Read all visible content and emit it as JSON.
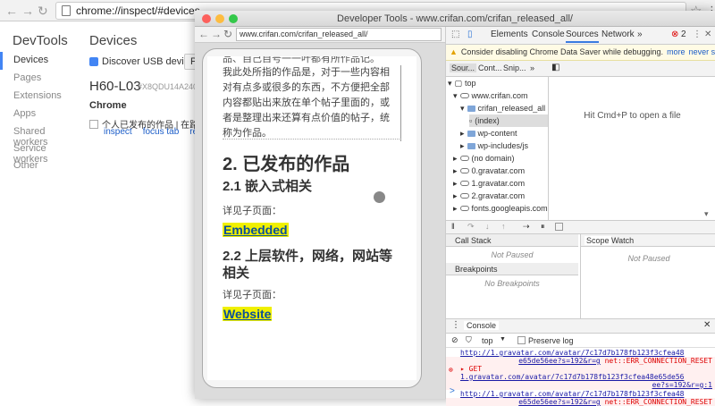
{
  "browser": {
    "url": "chrome://inspect/#devices"
  },
  "inspect": {
    "title": "DevTools",
    "sidebar": [
      "Devices",
      "Pages",
      "Extensions",
      "Apps",
      "Shared workers",
      "Service workers",
      "Other"
    ],
    "heading": "Devices",
    "discover_label": "Discover USB devices",
    "port_btn": "P",
    "device_model": "H60-L03",
    "device_serial": "#X8QDU14A2400",
    "chrome_label": "Chrome",
    "tab_title": "个人已发布的作品 | 在路上",
    "links": [
      "inspect",
      "focus tab",
      "reload"
    ]
  },
  "devtools": {
    "window_title": "Developer Tools - www.crifan.com/crifan_released_all/",
    "page_url": "www.crifan.com/crifan_released_all/",
    "page": {
      "top_clip": "品、自己自号一一叶都有所作品记。",
      "intro": "我此处所指的作品是，对于一些内容相对有点多或很多的东西，不方便把全部内容都贴出来放在单个帖子里面的，或者是整理出来还算有点价值的帖子，统称为作品。",
      "h2": "2. 已发布的作品",
      "h3a": "2.1 嵌入式相关",
      "see_a": "详见子页面：",
      "link_a": "Embedded",
      "h3b": "2.2 上层软件，网络，网站等相关",
      "see_b": "详见子页面：",
      "link_b": "Website"
    },
    "tabs": [
      "Elements",
      "Console",
      "Sources",
      "Network"
    ],
    "more_tabs": "»",
    "error_count": "2",
    "warning": "Consider disabling Chrome Data Saver while debugging.",
    "warning_more": "more",
    "warning_never": "never show",
    "sub_tabs": [
      "Sour...",
      "Cont...",
      "Snip...",
      "»"
    ],
    "tree": [
      {
        "label": "top"
      },
      {
        "label": "www.crifan.com"
      },
      {
        "label": "crifan_released_all"
      },
      {
        "label": "(index)"
      },
      {
        "label": "wp-content"
      },
      {
        "label": "wp-includes/js"
      },
      {
        "label": "(no domain)"
      },
      {
        "label": "0.gravatar.com"
      },
      {
        "label": "1.gravatar.com"
      },
      {
        "label": "2.gravatar.com"
      },
      {
        "label": "fonts.googleapis.com"
      }
    ],
    "editor_hint": "Hit Cmd+P to open a file",
    "call_stack": "Call Stack",
    "not_paused": "Not Paused",
    "breakpoints": "Breakpoints",
    "no_breakpoints": "No Breakpoints",
    "scope": "Scope",
    "watch": "Watch",
    "console_tab": "Console",
    "context": "top",
    "preserve_log": "Preserve log",
    "logs": {
      "l1": "http://1.gravatar.com/avatar/7c17d7b178fb123f3cfea48",
      "l2": "e65de56ee?s=192&r=g",
      "l2err": "net::ERR_CONNECTION_RESET",
      "e_get": "GET",
      "e_url1": "1.gravatar.com/avatar/7c17d7b178fb123f3cfea48e65de56",
      "e_url2": "ee?s=192&r=g:1",
      "l3": "http://1.gravatar.com/avatar/7c17d7b178fb123f3cfea48",
      "l4": "e65de56ee?s=192&r=g",
      "l4err": "net::ERR_CONNECTION_RESET"
    },
    "prompt": ">"
  }
}
